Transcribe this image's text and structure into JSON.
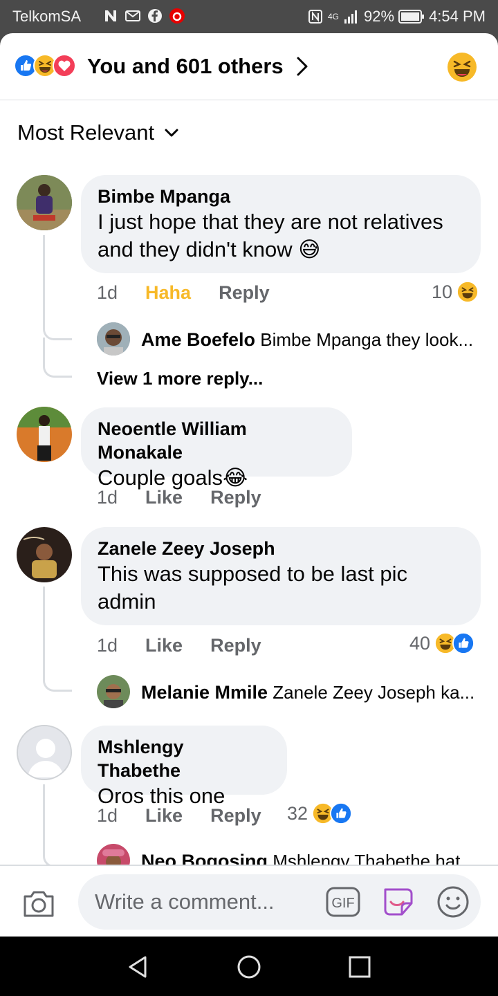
{
  "status_bar": {
    "carrier": "TelkomSA",
    "network": "4G",
    "battery": "92%",
    "time": "4:54 PM"
  },
  "header": {
    "reactions_text": "You and 601 others",
    "reaction_icons": [
      "like-icon",
      "haha-icon",
      "love-icon"
    ],
    "right_icon": "haha-icon"
  },
  "sort": {
    "label": "Most Relevant"
  },
  "comments": [
    {
      "author": "Bimbe Mpanga",
      "text": "I just hope that they are not relatives and they didn't know 😅",
      "time": "1d",
      "like_label": "Haha",
      "reply_label": "Reply",
      "reaction_count": "10",
      "reaction_icons": [
        "haha-icon"
      ],
      "replies": [
        {
          "author": "Ame Boefelo",
          "preview": "Bimbe Mpanga they look..."
        }
      ],
      "more_replies": "View 1 more reply..."
    },
    {
      "author": "Neoentle William Monakale",
      "text": "Couple goals😂",
      "time": "1d",
      "like_label": "Like",
      "reply_label": "Reply"
    },
    {
      "author": "Zanele Zeey Joseph",
      "text": "This was supposed to be last pic admin",
      "time": "1d",
      "like_label": "Like",
      "reply_label": "Reply",
      "reaction_count": "40",
      "reaction_icons": [
        "haha-icon",
        "like-icon"
      ],
      "replies": [
        {
          "author": "Melanie Mmile",
          "preview": "Zanele Zeey Joseph ka..."
        }
      ]
    },
    {
      "author": "Mshlengy Thabethe",
      "text": "Oros this one",
      "time": "1d",
      "like_label": "Like",
      "reply_label": "Reply",
      "reaction_count": "32",
      "reaction_icons": [
        "haha-icon",
        "like-icon"
      ],
      "replies": [
        {
          "author": "Neo Bogosing",
          "preview": "Mshlengy Thabethe  hat"
        }
      ]
    }
  ],
  "composer": {
    "placeholder": "Write a comment...",
    "gif_label": "GIF"
  },
  "colors": {
    "accent_blue": "#1877f2",
    "haha_yellow": "#f7b928",
    "love_red": "#f33e58",
    "bubble_bg": "#f0f2f5",
    "secondary_text": "#65676b"
  }
}
